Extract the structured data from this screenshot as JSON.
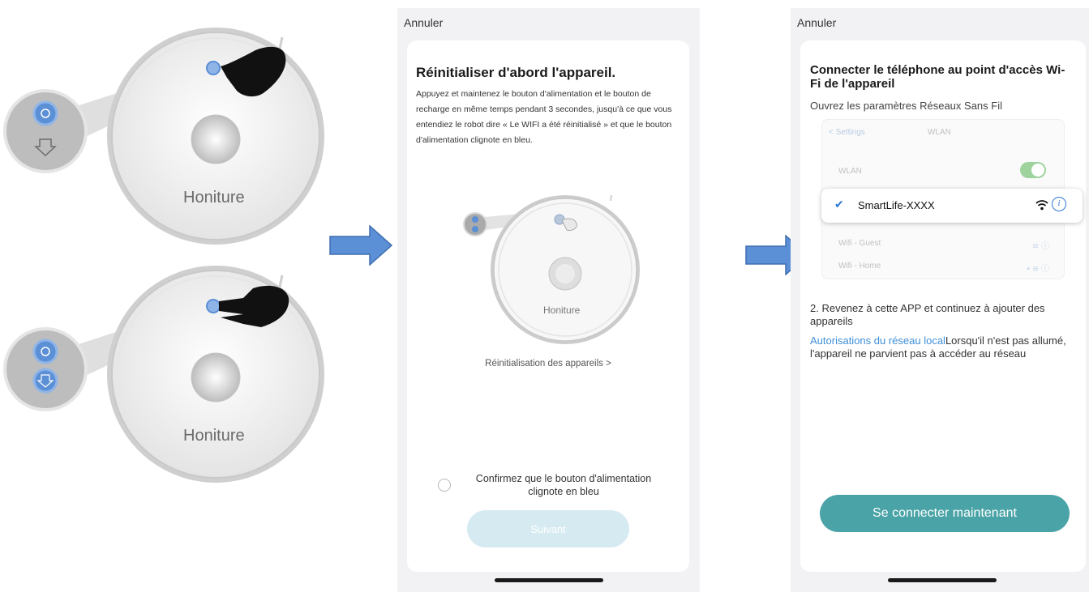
{
  "illustration": {
    "brand_top": "Honiture",
    "brand_bottom": "Honiture",
    "brand_mid": "Honiture"
  },
  "screen_reset": {
    "cancel_label": "Annuler",
    "title": "Réinitialiser d'abord l'appareil.",
    "description": "Appuyez et maintenez  le bouton d'alimentation et le bouton de recharge en même temps pendant 3 secondes, jusqu'à ce que vous entendiez le robot dire « Le WIFI a été réinitialisé » et que le bouton d'alimentation clignote en bleu.",
    "reset_devices_link": "Réinitialisation des appareils >",
    "confirm_text": "Confirmez que le bouton d'alimentation clignote en bleu",
    "next_button": "Suivant"
  },
  "screen_connect": {
    "cancel_label": "Annuler",
    "title": "Connecter le téléphone au point d'accès Wi-Fi de l'appareil",
    "subtitle": "Ouvrez les paramètres Réseaux Sans Fil",
    "wifi_settings": {
      "back_label": "< Settings",
      "header": "WLAN",
      "wlan_label": "WLAN",
      "selected_network": "SmartLife-XXXX",
      "other_networks": [
        "Wifi - Guest",
        "Wifi - Home"
      ]
    },
    "step2": "2. Revenez à cette APP et continuez à ajouter des appareils",
    "local_network_link": "Autorisations du réseau local",
    "local_network_text": "Lorsqu'il n'est pas allumé, l'appareil ne parvient pas à accéder au réseau",
    "connect_button": "Se connecter maintenant"
  },
  "colors": {
    "accent_teal": "#4aa3a6",
    "link_blue": "#3f8fd6",
    "disabled_button": "#d6ebf1",
    "arrow_blue": "#5b8fd6"
  }
}
